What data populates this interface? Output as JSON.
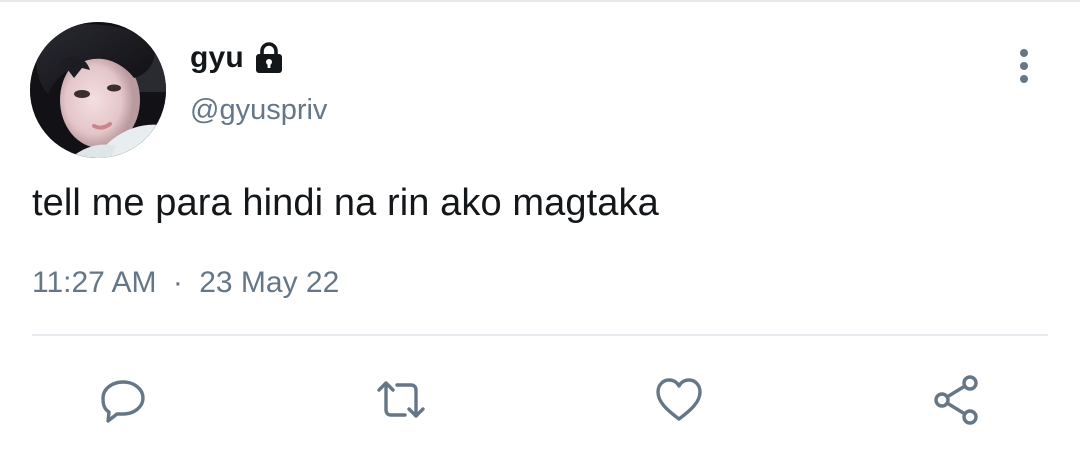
{
  "user": {
    "display_name": "gyu",
    "handle": "@gyuspriv",
    "protected_icon": "lock-icon",
    "avatar_icon": "profile-photo"
  },
  "tweet": {
    "text": "tell me para hindi na rin ako magtaka",
    "time": "11:27 AM",
    "separator": "·",
    "date": "23 May 22"
  },
  "actions": {
    "more": "more-vertical-icon",
    "reply": "reply-icon",
    "retweet": "retweet-icon",
    "like": "heart-icon",
    "share": "share-icon"
  },
  "colors": {
    "primary_text": "#14171a",
    "secondary_text": "#657786",
    "divider": "#e6ecf0"
  }
}
